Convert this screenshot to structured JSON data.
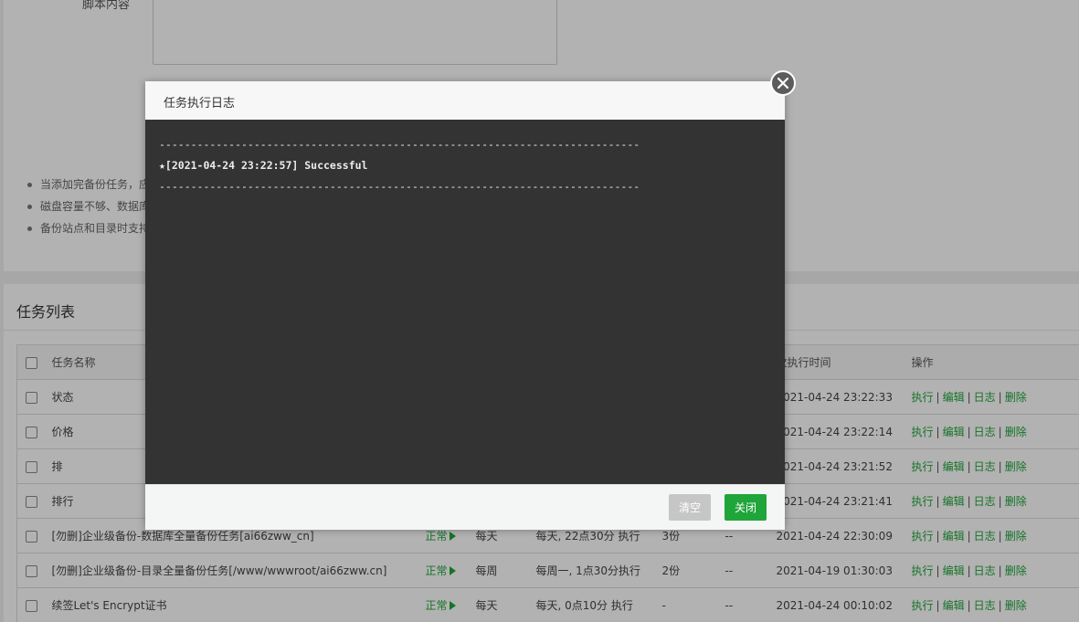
{
  "form": {
    "script_label": "脚本内容",
    "script_value": "",
    "tips": [
      "当添加完备份任务，应",
      "磁盘容量不够、数据库",
      "备份站点和目录时支持"
    ]
  },
  "task_list": {
    "title": "任务列表",
    "columns": [
      "",
      "任务名称",
      "",
      "",
      "",
      "",
      "",
      "次执行时间",
      "操作"
    ],
    "rows": [
      {
        "name": "状态",
        "status": "",
        "period": "",
        "cycle": "",
        "keep": "",
        "target": "",
        "last_run": "2021-04-24 23:22:33"
      },
      {
        "name": "价格",
        "status": "",
        "period": "",
        "cycle": "",
        "keep": "",
        "target": "",
        "last_run": "2021-04-24 23:22:14"
      },
      {
        "name": "排",
        "status": "",
        "period": "",
        "cycle": "",
        "keep": "",
        "target": "",
        "last_run": "2021-04-24 23:21:52"
      },
      {
        "name": "排行",
        "status": "",
        "period": "",
        "cycle": "",
        "keep": "",
        "target": "",
        "last_run": "2021-04-24 23:21:41"
      },
      {
        "name": "[勿删]企业级备份-数据库全量备份任务[ai66zww_cn]",
        "status": "正常",
        "period": "每天",
        "cycle": "每天, 22点30分 执行",
        "keep": "3份",
        "target": "--",
        "last_run": "2021-04-24 22:30:09"
      },
      {
        "name": "[勿删]企业级备份-目录全量备份任务[/www/wwwroot/ai66zww.cn]",
        "status": "正常",
        "period": "每周",
        "cycle": "每周一, 1点30分执行",
        "keep": "2份",
        "target": "--",
        "last_run": "2021-04-19 01:30:03"
      },
      {
        "name": "续签Let's Encrypt证书",
        "status": "正常",
        "period": "每天",
        "cycle": "每天, 0点10分 执行",
        "keep": "-",
        "target": "--",
        "last_run": "2021-04-24 00:10:02"
      }
    ],
    "operations": [
      "执行",
      "编辑",
      "日志",
      "删除"
    ],
    "op_separator": "|"
  },
  "modal": {
    "title": "任务执行日志",
    "log_lines": [
      "----------------------------------------------------------------------------",
      "★[2021-04-24 23:22:57] Successful",
      "----------------------------------------------------------------------------"
    ],
    "clear_label": "清空",
    "close_label": "关闭"
  },
  "colors": {
    "accent_green": "#20a53a",
    "log_background": "#333333",
    "clear_button": "#c6c6c6"
  },
  "icons": {
    "close": "close-icon",
    "status_play": "play-icon"
  }
}
